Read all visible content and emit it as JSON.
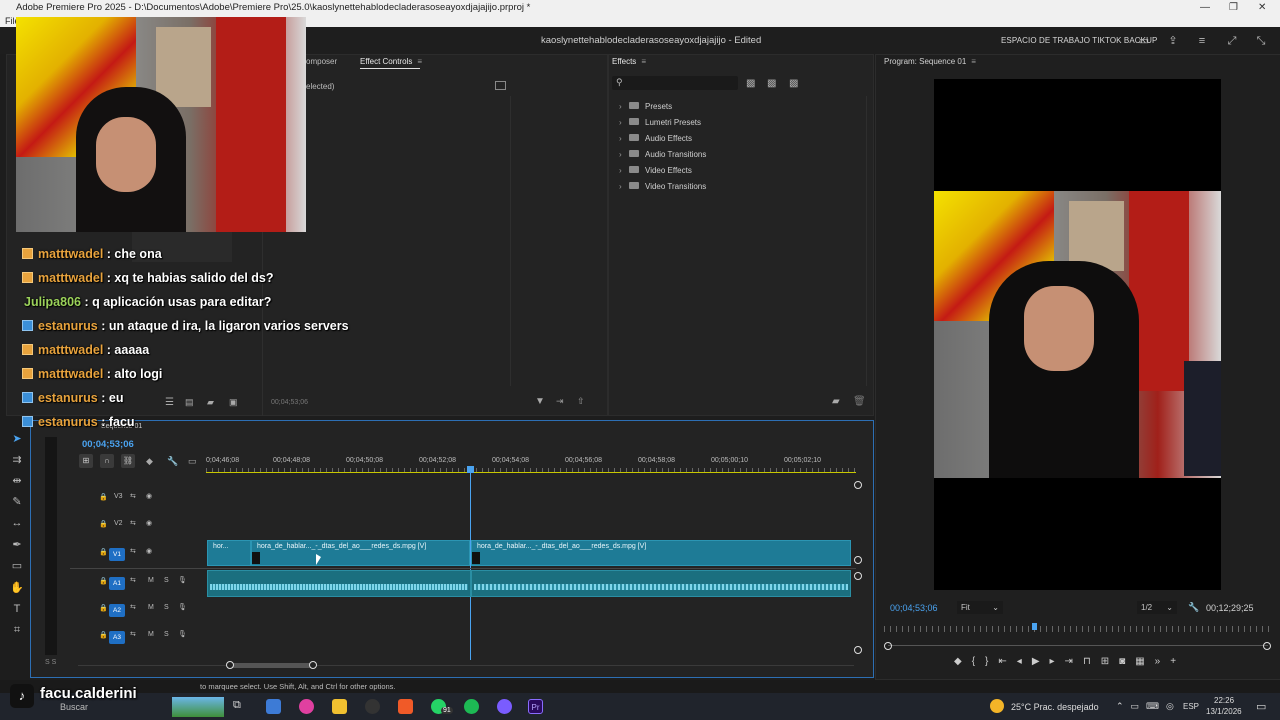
{
  "titlebar": {
    "title": "Adobe Premiere Pro 2025 - D:\\Documentos\\Adobe\\Premiere Pro\\25.0\\kaoslynettehablodecladerasoseayoxdjajajijo.prproj *"
  },
  "menubar": {
    "first": "File"
  },
  "header": {
    "project": "kaoslynettehablodecladerasoseayoxdjajajijo - Edited",
    "workspace": "ESPACIO DE TRABAJO TIKTOK BACKUP"
  },
  "source_panel": {
    "tab_composer": "omposer",
    "tab_effect_controls": "Effect Controls",
    "no_clip": "elected)",
    "timecode": "00;04;53;06",
    "seq_label": "Sequence 01"
  },
  "effects_panel": {
    "tab": "Effects",
    "search_placeholder": "",
    "items": [
      "Presets",
      "Lumetri Presets",
      "Audio Effects",
      "Audio Transitions",
      "Video Effects",
      "Video Transitions"
    ]
  },
  "program_monitor": {
    "tab": "Program: Sequence 01",
    "timecode": "00;04;53;06",
    "fit": "Fit",
    "resolution": "1/2",
    "duration": "00;12;29;25"
  },
  "timeline": {
    "sequence_tab": "Sequence 01",
    "timecode": "00;04;53;06",
    "ruler": [
      "0;04;46;08",
      "00;04;48;08",
      "00;04;50;08",
      "00;04;52;08",
      "00;04;54;08",
      "00;04;56;08",
      "00;04;58;08",
      "00;05;00;10",
      "00;05;02;10"
    ],
    "tracks": {
      "v3": "V3",
      "v2": "V2",
      "v1": "V1",
      "a1": "A1",
      "a2": "A2",
      "a3": "A3",
      "m": "M",
      "s": "S"
    },
    "clips": {
      "c1": "hor...",
      "c2": "hora_de_hablar..._-_dtas_del_ao___redes_ds.mpg [V]",
      "c3": "hora_de_hablar..._-_dtas_del_ao___redes_ds.mpg [V]"
    }
  },
  "statusbar": {
    "text": "to marquee select. Use Shift, Alt, and Ctrl for other options."
  },
  "chat": [
    {
      "user": "matttwadel",
      "msg": ": che ona"
    },
    {
      "user": "matttwadel",
      "msg": ": xq te habias salido del ds?"
    },
    {
      "user": "Julipa806",
      "msg": ": q aplicación usas para editar?"
    },
    {
      "user": "estanurus",
      "msg": ": un ataque d ira, la ligaron varios servers"
    },
    {
      "user": "matttwadel",
      "msg": ": aaaaa"
    },
    {
      "user": "matttwadel",
      "msg": ": alto logi"
    },
    {
      "user": "estanurus",
      "msg": ": eu"
    },
    {
      "user": "estanurus",
      "msg": ": facu"
    }
  ],
  "tiktok": {
    "handle": "facu.calderini"
  },
  "taskbar": {
    "weather": "25°C  Prac. despejado",
    "lang": "ESP",
    "time": "22:26",
    "date": "13/1/2026",
    "search": "Buscar",
    "badge": "91"
  }
}
